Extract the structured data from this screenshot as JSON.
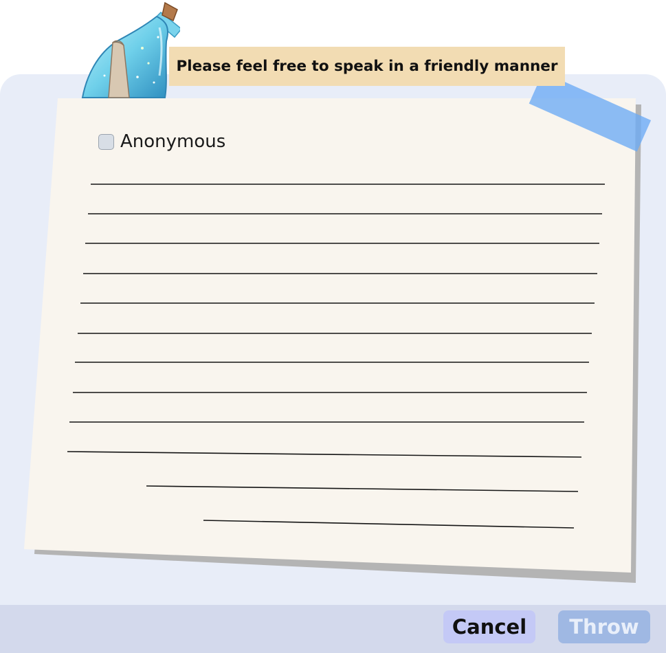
{
  "header": {
    "banner_text": "Please feel free to speak in a friendly manner"
  },
  "anonymous": {
    "label": "Anonymous",
    "checked": false
  },
  "message": {
    "value": "",
    "ruled_line_count": 12
  },
  "footer": {
    "cancel_label": "Cancel",
    "throw_label": "Throw"
  },
  "colors": {
    "panel_background": "#e8edf8",
    "paper": "#f9f5ee",
    "banner": "#f2dcb3",
    "tape": "#6caaf5",
    "cancel_button": "#c4c9f6",
    "throw_button": "#9fb8e3",
    "footer_bar": "#d3d9ec"
  },
  "icons": {
    "decoration": "message-in-bottle-icon",
    "checkbox": "checkbox-unchecked-icon"
  }
}
